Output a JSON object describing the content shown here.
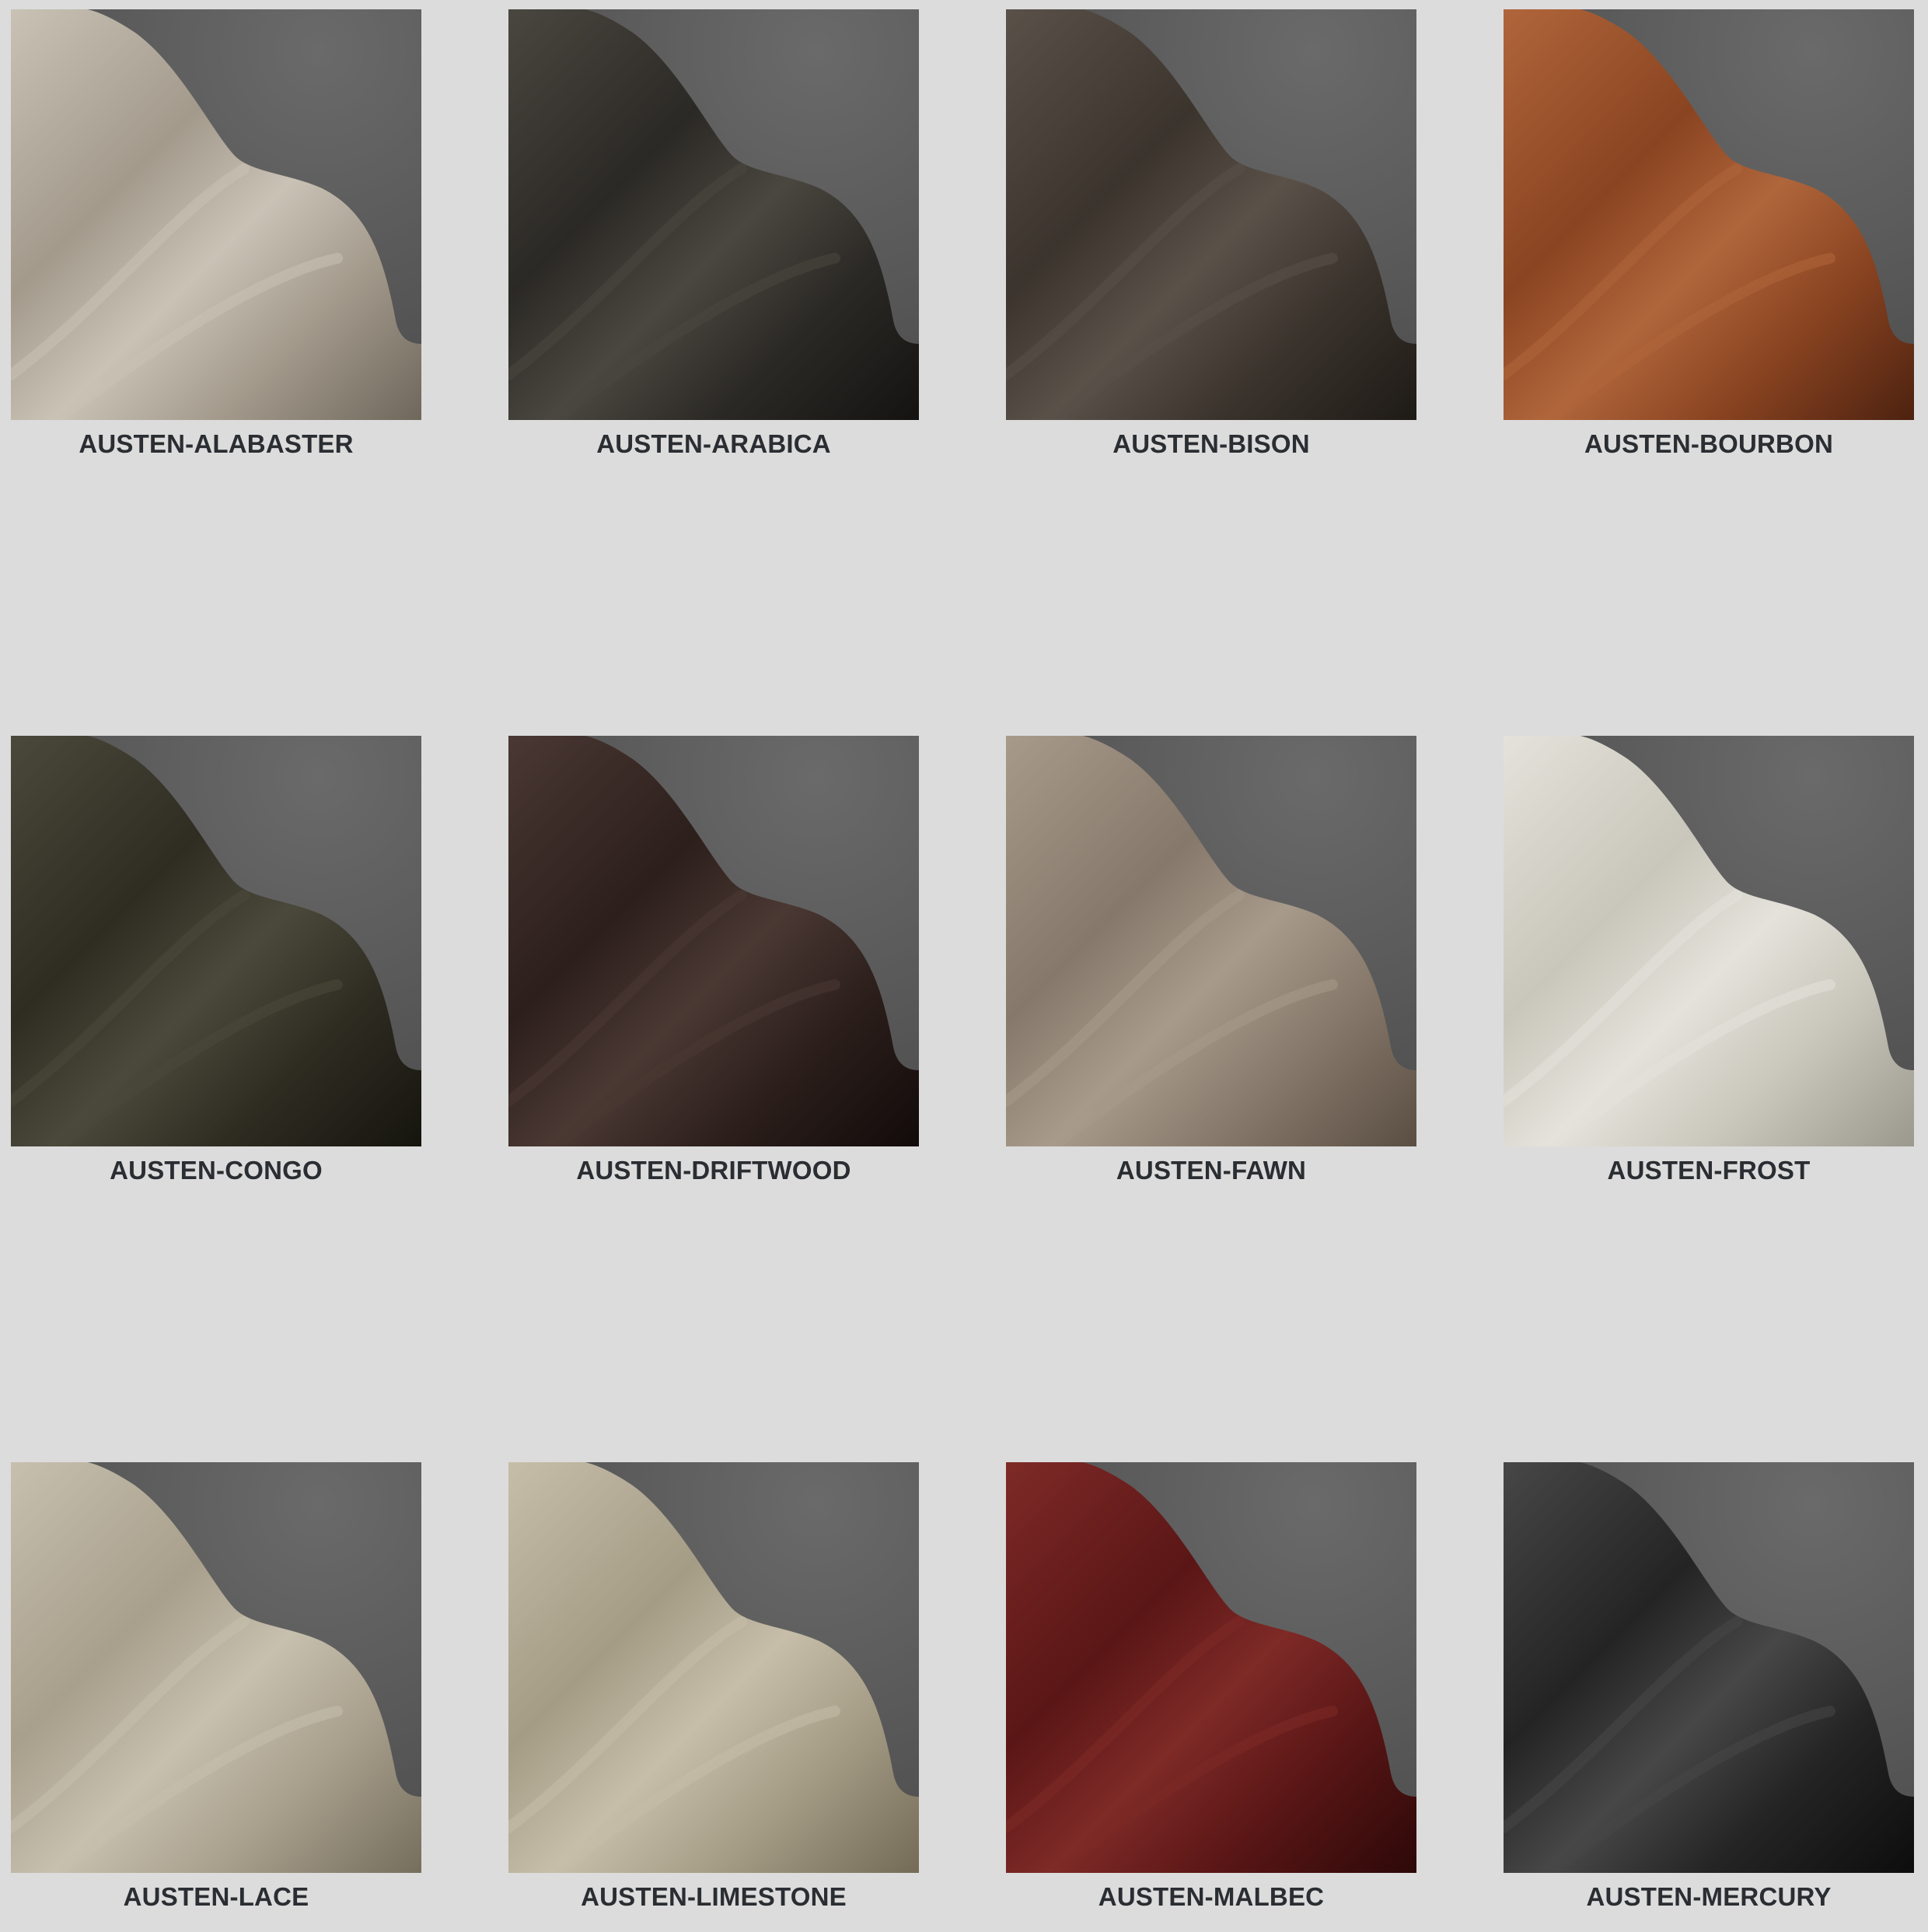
{
  "swatches": [
    {
      "name": "AUSTEN-ALABASTER",
      "color": "#a39a8c",
      "highlight": "#c9c2b5",
      "shadow": "#6f675b"
    },
    {
      "name": "AUSTEN-ARABICA",
      "color": "#2b2925",
      "highlight": "#4a4740",
      "shadow": "#141311"
    },
    {
      "name": "AUSTEN-BISON",
      "color": "#3b342d",
      "highlight": "#5a5149",
      "shadow": "#1e1a16"
    },
    {
      "name": "AUSTEN-BOURBON",
      "color": "#8a4421",
      "highlight": "#b0663b",
      "shadow": "#4d2210"
    },
    {
      "name": "AUSTEN-CONGO",
      "color": "#2f2d22",
      "highlight": "#4b493b",
      "shadow": "#15140e"
    },
    {
      "name": "AUSTEN-DRIFTWOOD",
      "color": "#2c1f1c",
      "highlight": "#4a3833",
      "shadow": "#120b0a"
    },
    {
      "name": "AUSTEN-FAWN",
      "color": "#86786a",
      "highlight": "#a89a8b",
      "shadow": "#5a4e43"
    },
    {
      "name": "AUSTEN-FROST",
      "color": "#c9c6bb",
      "highlight": "#e4e2da",
      "shadow": "#9b988d"
    },
    {
      "name": "AUSTEN-LACE",
      "color": "#a89f8c",
      "highlight": "#c7c0ae",
      "shadow": "#766e5d"
    },
    {
      "name": "AUSTEN-LIMESTONE",
      "color": "#a59c86",
      "highlight": "#c6bea9",
      "shadow": "#746b57"
    },
    {
      "name": "AUSTEN-MALBEC",
      "color": "#5a1616",
      "highlight": "#7e2a27",
      "shadow": "#2d0808"
    },
    {
      "name": "AUSTEN-MERCURY",
      "color": "#242424",
      "highlight": "#474747",
      "shadow": "#0d0d0d"
    }
  ]
}
